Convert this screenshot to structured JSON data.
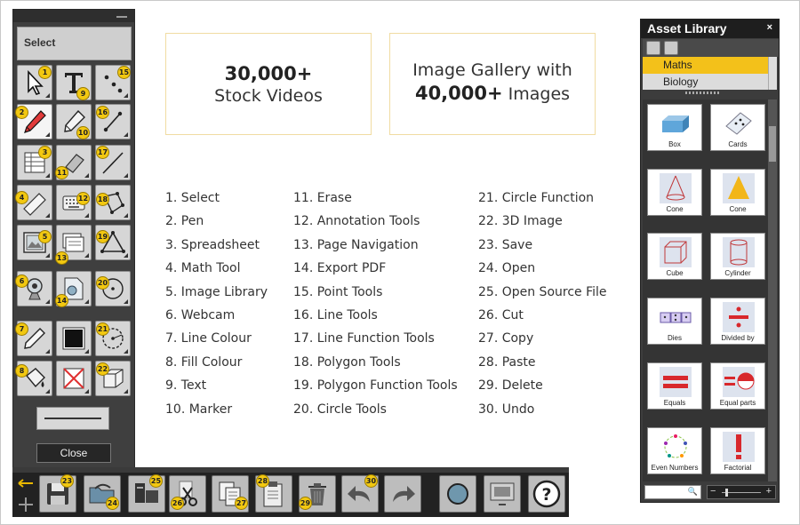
{
  "toolbox": {
    "select_label": "Select",
    "close_label": "Close",
    "badges": [
      "1",
      "2",
      "3",
      "4",
      "5",
      "6",
      "7",
      "8",
      "9",
      "10",
      "11",
      "12",
      "13",
      "14",
      "15",
      "16",
      "17",
      "18",
      "19",
      "20",
      "21",
      "22"
    ]
  },
  "bottombar": {
    "badges": [
      "23",
      "24",
      "25",
      "26",
      "27",
      "28",
      "29",
      "30"
    ]
  },
  "info": {
    "videos_count": "30,000+",
    "videos_text": "Stock Videos",
    "gallery_line1": "Image Gallery with",
    "gallery_count": "40,000+",
    "gallery_text": "Images"
  },
  "legend": [
    [
      "1. Select",
      "2. Pen",
      "3. Spreadsheet",
      "4. Math Tool",
      "5. Image Library",
      "6. Webcam",
      "7. Line Colour",
      "8. Fill Colour",
      "9. Text",
      "10.  Marker"
    ],
    [
      "11. Erase",
      "12. Annotation Tools",
      "13. Page Navigation",
      "14. Export PDF",
      "15. Point Tools",
      "16. Line Tools",
      "17. Line Function Tools",
      "18. Polygon Tools",
      "19. Polygon Function Tools",
      "20. Circle Tools"
    ],
    [
      "21. Circle Function",
      "22. 3D Image",
      "23. Save",
      "24. Open",
      "25. Open Source File",
      "26. Cut",
      "27. Copy",
      "28. Paste",
      "29. Delete",
      "30. Undo"
    ]
  ],
  "asset_library": {
    "title": "Asset Library",
    "close": "×",
    "categories": [
      "Maths",
      "Biology"
    ],
    "selected_category": "Maths",
    "items": [
      "Box",
      "Cards",
      "Cone",
      "Cone",
      "Cube",
      "Cylinder",
      "Dies",
      "Divided by",
      "Equals",
      "Equal parts",
      "Even Numbers",
      "Factorial"
    ],
    "zoom_minus": "−",
    "zoom_plus": "+"
  },
  "colors": {
    "badge": "#f2c811",
    "highlight": "#f3c11a",
    "box_border": "#f0dca2",
    "panel": "#3f3f3f"
  }
}
